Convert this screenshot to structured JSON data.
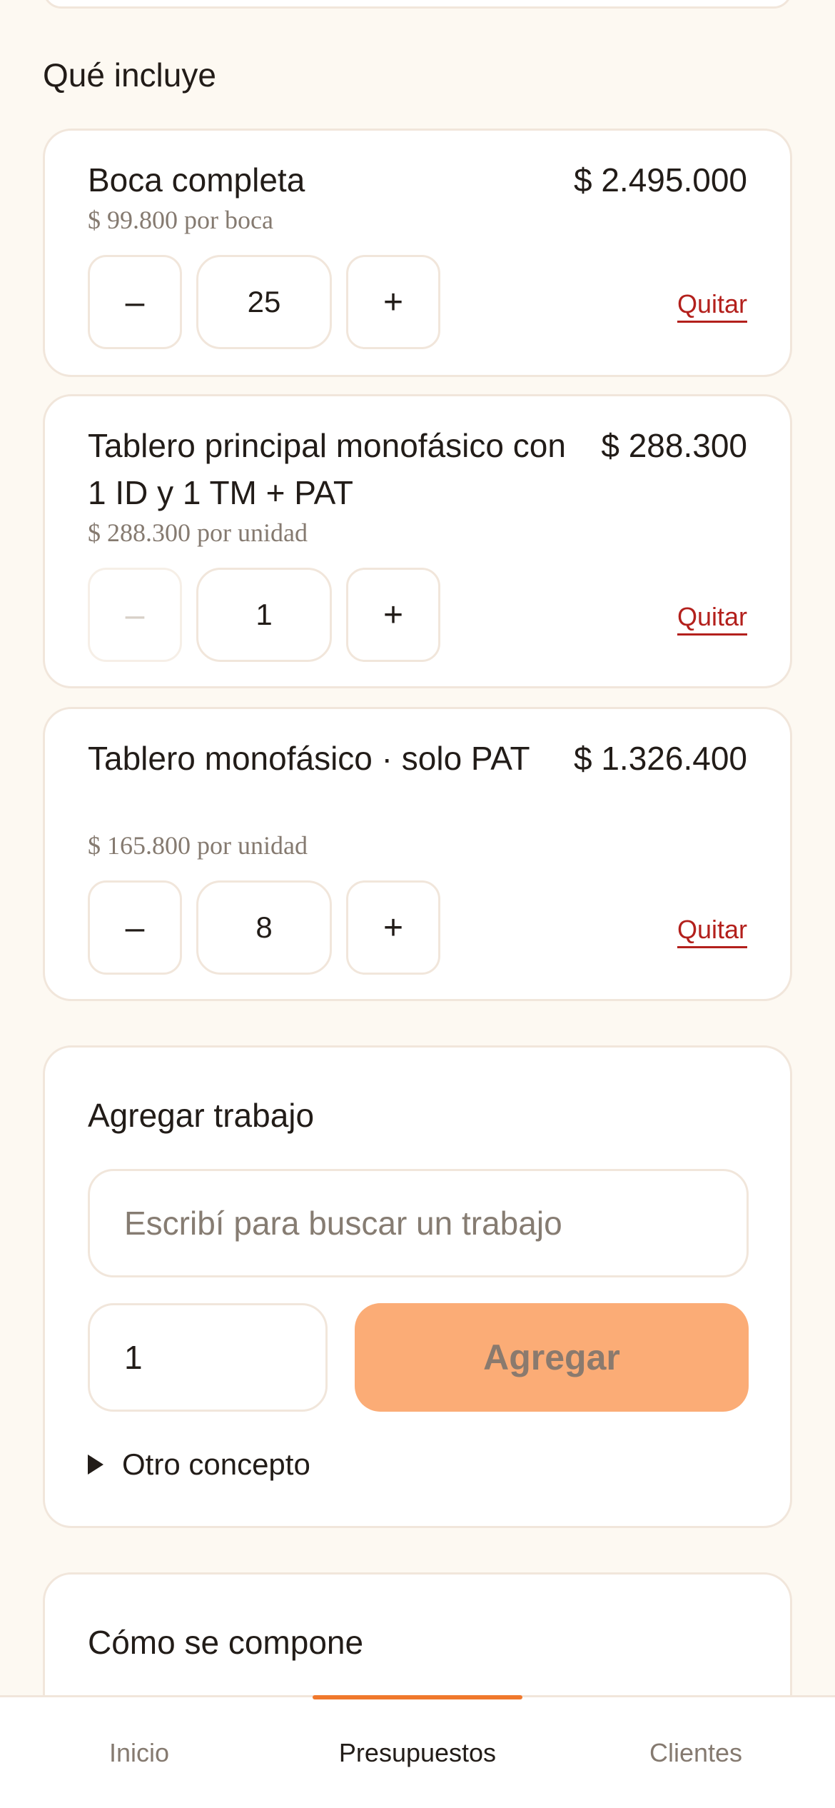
{
  "section": {
    "title": "Qué incluye"
  },
  "items": [
    {
      "name": "Boca completa",
      "unit_price": "$ 99.800 por boca",
      "total": "$ 2.495.000",
      "quantity": "25",
      "decrement_label": "–",
      "increment_label": "+",
      "remove_label": "Quitar",
      "decrement_disabled": false
    },
    {
      "name": "Tablero principal monofásico con 1 ID y 1 TM + PAT",
      "unit_price": "$ 288.300 por unidad",
      "total": "$ 288.300",
      "quantity": "1",
      "decrement_label": "–",
      "increment_label": "+",
      "remove_label": "Quitar",
      "decrement_disabled": true
    },
    {
      "name": "Tablero monofásico · solo PAT",
      "unit_price": "$ 165.800 por unidad",
      "total": "$ 1.326.400",
      "quantity": "8",
      "decrement_label": "–",
      "increment_label": "+",
      "remove_label": "Quitar",
      "decrement_disabled": false
    }
  ],
  "add_job": {
    "title": "Agregar trabajo",
    "search_placeholder": "Escribí para buscar un trabajo",
    "search_value": "",
    "quantity_value": "1",
    "add_button_label": "Agregar",
    "other_concept_label": "Otro concepto"
  },
  "compose": {
    "title": "Cómo se compone"
  },
  "nav": {
    "tabs": [
      {
        "label": "Inicio",
        "active": false
      },
      {
        "label": "Presupuestos",
        "active": true
      },
      {
        "label": "Clientes",
        "active": false
      }
    ]
  },
  "colors": {
    "background": "#fdf9f2",
    "accent": "#f0782c",
    "add_button": "#fbac76",
    "danger": "#b3201c"
  }
}
